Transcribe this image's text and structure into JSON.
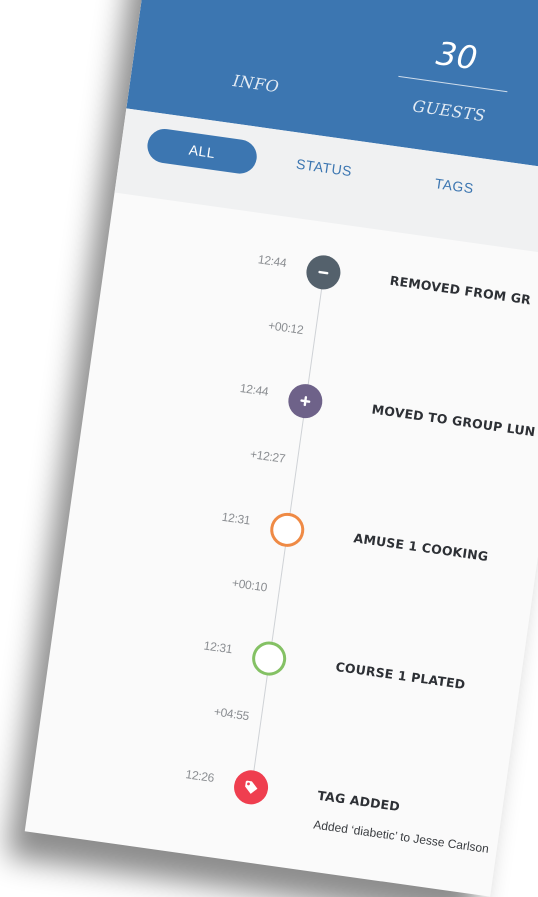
{
  "header": {
    "count": "30",
    "tabs": [
      {
        "label": "INFO"
      },
      {
        "label": "GUESTS"
      }
    ]
  },
  "filters": {
    "items": [
      {
        "label": "ALL",
        "active": true
      },
      {
        "label": "STATUS",
        "active": false
      },
      {
        "label": "TAGS",
        "active": false
      }
    ]
  },
  "timeline": {
    "events": [
      {
        "time": "12:44",
        "delta": "+00:12",
        "title": "REMOVED FROM GR",
        "icon": "minus-icon",
        "color": "#54616c"
      },
      {
        "time": "12:44",
        "delta": "+12:27",
        "title": "MOVED TO GROUP LUN",
        "icon": "plus-icon",
        "color": "#6e6289"
      },
      {
        "time": "12:31",
        "delta": "+00:10",
        "title": "AMUSE 1 COOKING",
        "icon": "ring-icon",
        "color": "#ef8a45"
      },
      {
        "time": "12:31",
        "delta": "+04:55",
        "title": "COURSE 1 PLATED",
        "icon": "ring-icon",
        "color": "#84c164"
      },
      {
        "time": "12:26",
        "delta": "",
        "title": "TAG ADDED",
        "desc": "Added ‘diabetic’ to Jesse Carlson",
        "icon": "tag-icon",
        "color": "#ef3e4f"
      }
    ]
  }
}
